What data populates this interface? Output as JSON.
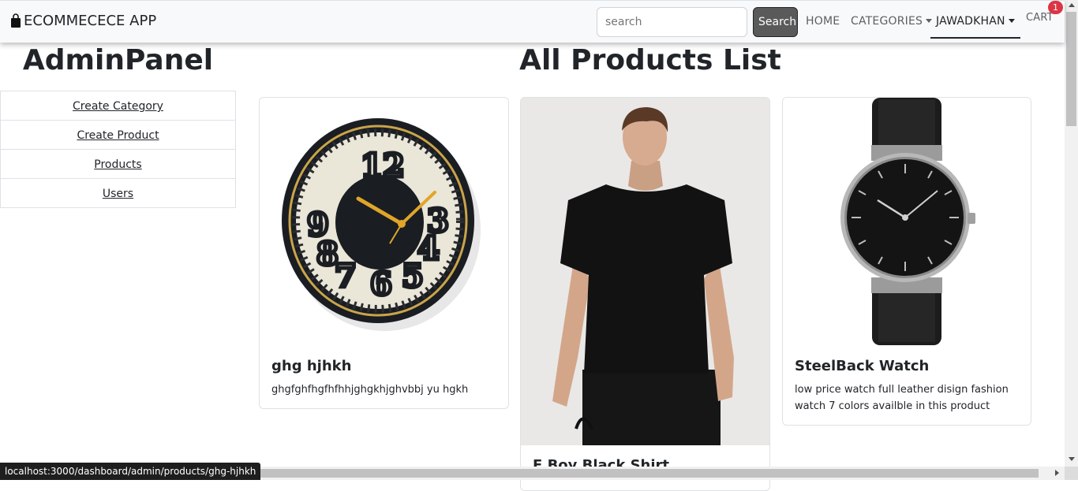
{
  "navbar": {
    "brand": "ECOMMECECE APP",
    "search_placeholder": "search",
    "search_button": "Search",
    "home": "HOME",
    "categories": "CATEGORIES",
    "user": "JAWADKHAN",
    "cart": "CART",
    "cart_count": "1",
    "cart_badge_color": "#dc3545",
    "brand_icon": "shopping-bag-icon"
  },
  "admin": {
    "title": "AdminPanel",
    "menu": [
      {
        "label": "Create Category"
      },
      {
        "label": "Create Product"
      },
      {
        "label": "Products",
        "active": true
      },
      {
        "label": "Users"
      }
    ]
  },
  "products": {
    "title": "All Products List",
    "items": [
      {
        "name": "ghg hjhkh",
        "description": "ghgfghfhgfhfhhjghgkhjghvbbj yu hgkh",
        "image": "wall-clock-image"
      },
      {
        "name": "F Boy Black Shirt",
        "description": "",
        "image": "black-tshirt-model-image"
      },
      {
        "name": "SteelBack Watch",
        "description": "low price watch full leather disign fashion watch 7 colors availble in this product",
        "image": "wrist-watch-image"
      }
    ]
  },
  "status_bar": {
    "url": "localhost:3000/dashboard/admin/products/ghg-hjhkh"
  }
}
